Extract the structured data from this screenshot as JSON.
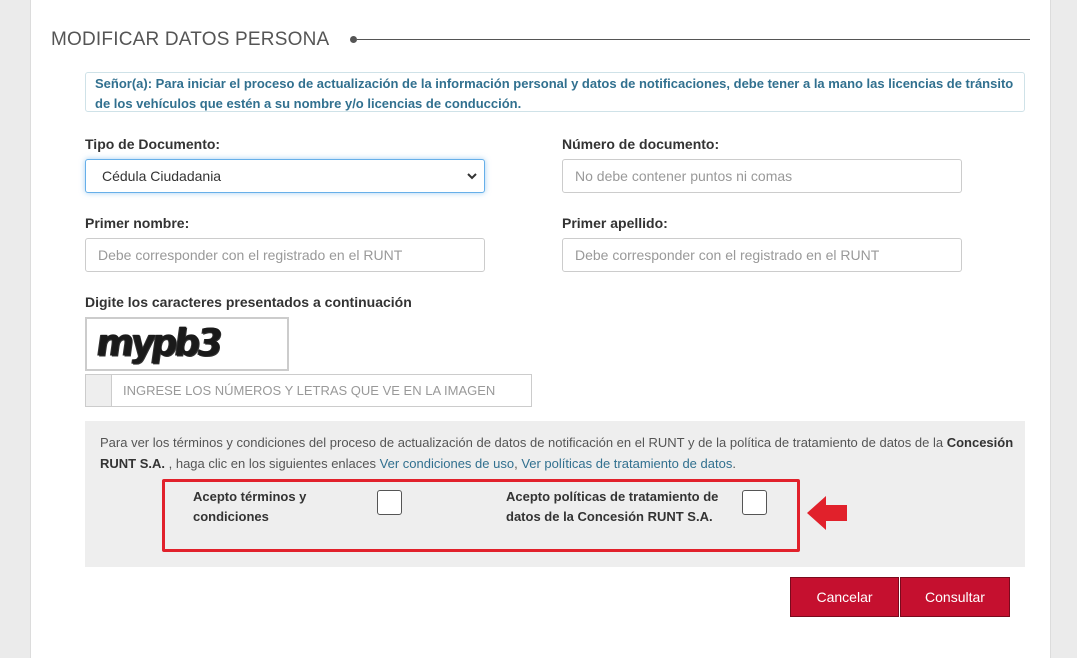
{
  "form": {
    "title": "MODIFICAR DATOS PERSONA",
    "notice": "Señor(a): Para iniciar el proceso de actualización de la información personal y datos de notificaciones, debe tener a la mano las licencias de tránsito de los vehículos que estén a su nombre y/o licencias de conducción.",
    "doc_type_label": "Tipo de Documento:",
    "doc_type_value": "Cédula Ciudadania",
    "doc_number_label": "Número de documento:",
    "doc_number_placeholder": "No debe contener puntos ni comas",
    "first_name_label": "Primer nombre:",
    "first_name_placeholder": "Debe corresponder con el registrado en el RUNT",
    "last_name_label": "Primer apellido:",
    "last_name_placeholder": "Debe corresponder con el registrado en el RUNT",
    "captcha_label": "Digite los caracteres presentados a continuación",
    "captcha_image_text": "mypb3",
    "captcha_placeholder": "INGRESE LOS NÚMEROS Y LETRAS QUE VE EN LA IMAGEN"
  },
  "terms": {
    "text_part1": "Para ver los términos y condiciones del proceso de actualización de datos de notificación en el RUNT y de la política de tratamiento de datos de la ",
    "company": "Concesión RUNT S.A.",
    "text_part2": " , haga clic en los siguientes enlaces ",
    "link_conditions": "Ver condiciones de uso",
    "separator": ", ",
    "link_policies": "Ver políticas de tratamiento de datos",
    "period": ".",
    "accept_terms_label": "Acepto términos y condiciones",
    "accept_policies_label": "Acepto políticas de tratamiento de datos de la Concesión RUNT S.A."
  },
  "buttons": {
    "cancel": "Cancelar",
    "submit": "Consultar"
  },
  "colors": {
    "accent_red": "#c5102f",
    "highlight_red": "#e1212b",
    "notice_text": "#31708f"
  }
}
